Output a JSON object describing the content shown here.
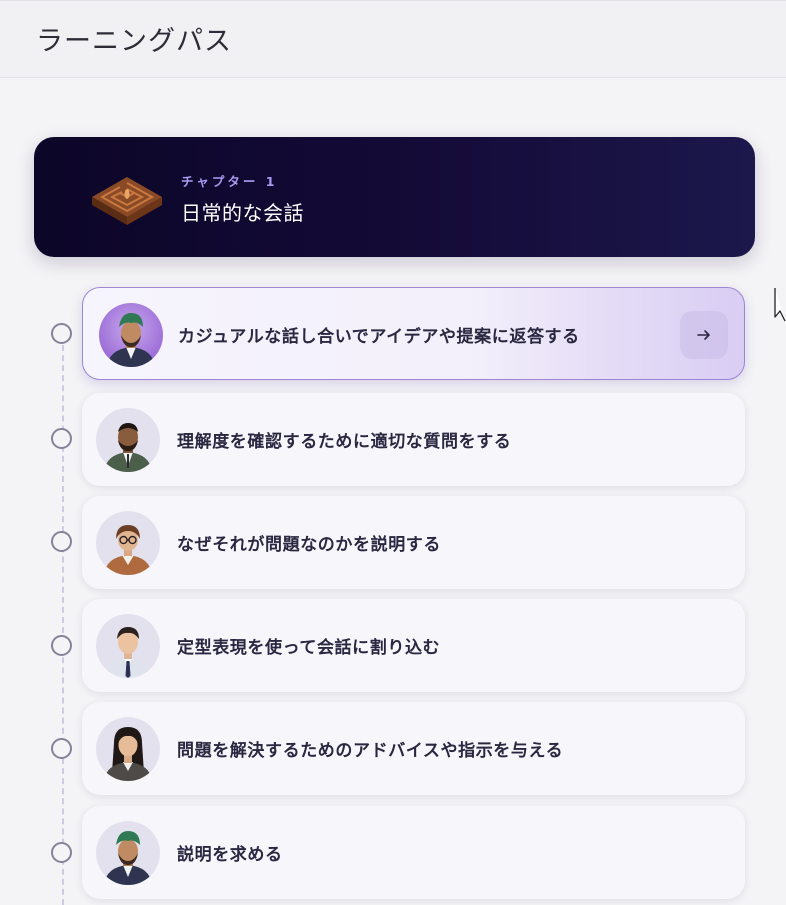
{
  "header": {
    "title": "ラーニングパス"
  },
  "chapter": {
    "label": "チャプター 1",
    "title": "日常的な会話",
    "icon": "maze-icon"
  },
  "lessons": [
    {
      "title": "カジュアルな話し合いでアイデアや提案に返答する",
      "active": true,
      "avatar": "man-turban-avatar"
    },
    {
      "title": "理解度を確認するために適切な質問をする",
      "active": false,
      "avatar": "man-beard-avatar"
    },
    {
      "title": "なぜそれが問題なのかを説明する",
      "active": false,
      "avatar": "woman-glasses-avatar"
    },
    {
      "title": "定型表現を使って会話に割り込む",
      "active": false,
      "avatar": "man-tie-avatar"
    },
    {
      "title": "問題を解決するためのアドバイスや指示を与える",
      "active": false,
      "avatar": "woman-longhair-avatar"
    },
    {
      "title": "説明を求める",
      "active": false,
      "avatar": "man-turban-avatar"
    }
  ],
  "colors": {
    "banner": "#140b38",
    "accent": "#9b86d4",
    "chapter_label": "#a99bf2"
  }
}
